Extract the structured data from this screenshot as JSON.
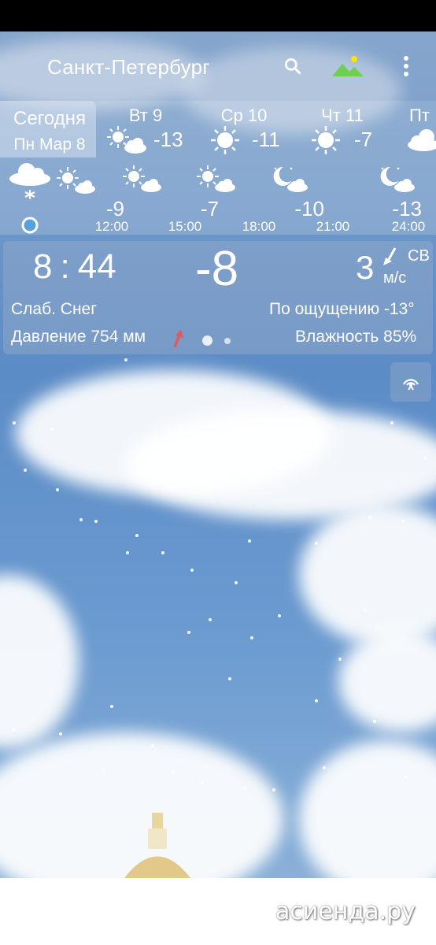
{
  "header": {
    "city": "Санкт-Петербург"
  },
  "icons": {
    "search": "search-icon",
    "wallpaper": "landscape-icon",
    "menu": "more-vert-icon",
    "share": "broadcast-icon"
  },
  "days": [
    {
      "label": "Сегодня",
      "date": "Пн Мар 8",
      "selected": true
    },
    {
      "label": "Вт 9",
      "temp": "-13",
      "icon": "partly-cloudy-icon"
    },
    {
      "label": "Ср 10",
      "temp": "-11",
      "icon": "sun-icon"
    },
    {
      "label": "Чт 11",
      "temp": "-7",
      "icon": "sun-icon"
    },
    {
      "label": "Пт",
      "icon": "cloud-icon"
    }
  ],
  "hours": [
    {
      "time": "12:00",
      "temp": "-9",
      "icon": "partly-cloudy-icon"
    },
    {
      "time": "15:00",
      "temp": "-7",
      "icon": "partly-cloudy-icon"
    },
    {
      "time": "18:00",
      "temp": "-10",
      "icon": "night-cloudy-icon"
    },
    {
      "time": "21:00",
      "temp": "-13",
      "icon": "night-cloudy-icon"
    },
    {
      "time": "24:00",
      "temp": "",
      "icon": "night-cloudy-icon"
    }
  ],
  "hour_temps_display": [
    "-9",
    "-7",
    "-10",
    "-13"
  ],
  "hour_times_display": [
    "12:00",
    "15:00",
    "18:00",
    "21:00",
    "24:00"
  ],
  "current": {
    "time_hours": "8",
    "time_minutes": "44",
    "temp": "-8",
    "condition": "Слаб. Снег",
    "pressure": "Давление 754 мм",
    "feels_like": "По ощущению -13°",
    "humidity": "Влажность 85%",
    "wind_speed": "3",
    "wind_unit": "м/с",
    "wind_dir": "СВ"
  },
  "pager": {
    "pages": 2,
    "active_index": 0
  },
  "watermark": "асиенда.ру",
  "colors": {
    "pressure_arrow": "#e05a5a",
    "sun": "#ffd200"
  }
}
